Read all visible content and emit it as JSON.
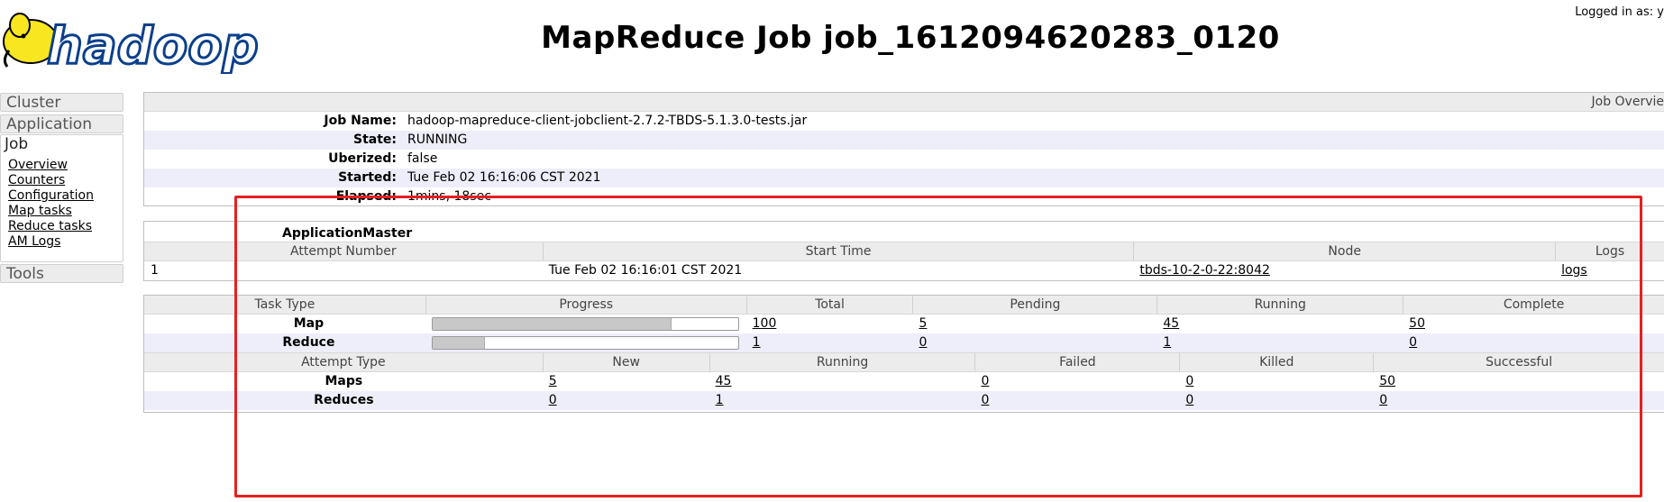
{
  "header": {
    "logo_text": "hadoop",
    "title": "MapReduce Job job_1612094620283_0120",
    "logged_in": "Logged in as: y"
  },
  "nav": {
    "cluster": "Cluster",
    "application": "Application",
    "job": "Job",
    "job_links": [
      "Overview",
      "Counters",
      "Configuration",
      "Map tasks",
      "Reduce tasks",
      "AM Logs"
    ],
    "tools": "Tools"
  },
  "overview": {
    "header": "Job Overvie",
    "rows": [
      {
        "label": "Job Name:",
        "value": "hadoop-mapreduce-client-jobclient-2.7.2-TBDS-5.1.3.0-tests.jar"
      },
      {
        "label": "State:",
        "value": "RUNNING"
      },
      {
        "label": "Uberized:",
        "value": "false"
      },
      {
        "label": "Started:",
        "value": "Tue Feb 02 16:16:06 CST 2021"
      },
      {
        "label": "Elapsed:",
        "value": "1mins, 18sec"
      }
    ]
  },
  "am": {
    "title": "ApplicationMaster",
    "columns": [
      "Attempt Number",
      "Start Time",
      "Node",
      "Logs"
    ],
    "row": {
      "attempt": "1",
      "start_time": "Tue Feb 02 16:16:01 CST 2021",
      "node": "tbds-10-2-0-22:8042",
      "logs": "logs"
    }
  },
  "tasks": {
    "columns": [
      "Task Type",
      "Progress",
      "Total",
      "Pending",
      "Running",
      "Complete"
    ],
    "rows": [
      {
        "type": "Map",
        "progress": 0.78,
        "total": "100",
        "pending": "5",
        "running": "45",
        "complete": "50"
      },
      {
        "type": "Reduce",
        "progress": 0.17,
        "total": "1",
        "pending": "0",
        "running": "1",
        "complete": "0"
      }
    ]
  },
  "attempts": {
    "columns": [
      "Attempt Type",
      "New",
      "Running",
      "Failed",
      "Killed",
      "Successful"
    ],
    "rows": [
      {
        "type": "Maps",
        "new": "5",
        "running": "45",
        "failed": "0",
        "killed": "0",
        "successful": "50"
      },
      {
        "type": "Reduces",
        "new": "0",
        "running": "1",
        "failed": "0",
        "killed": "0",
        "successful": "0"
      }
    ]
  },
  "colors": {
    "highlight_box": "#e62020",
    "alt_row": "#eeeefa",
    "header_bg": "#ececec"
  }
}
